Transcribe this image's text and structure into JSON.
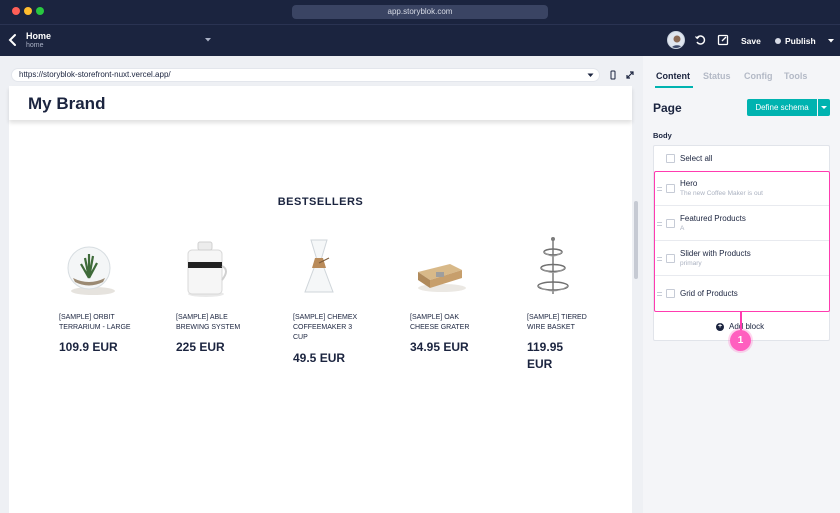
{
  "window": {
    "url": "app.storyblok.com"
  },
  "header": {
    "title": "Home",
    "subtitle": "home",
    "save_label": "Save",
    "publish_label": "Publish"
  },
  "preview": {
    "url": "https://storyblok-storefront-nuxt.vercel.app/",
    "brand": "My Brand",
    "section_title": "BESTSELLERS",
    "products": [
      {
        "name": "[SAMPLE] ORBIT TERRARIUM - LARGE",
        "price": "109.9 EUR"
      },
      {
        "name": "[SAMPLE] ABLE BREWING SYSTEM",
        "price": "225 EUR"
      },
      {
        "name": "[SAMPLE] CHEMEX COFFEEMAKER 3 CUP",
        "price": "49.5 EUR"
      },
      {
        "name": "[SAMPLE] OAK CHEESE GRATER",
        "price": "34.95 EUR"
      },
      {
        "name": "[SAMPLE] TIERED WIRE BASKET",
        "price": "119.95 EUR"
      }
    ]
  },
  "panel": {
    "tabs": [
      "Content",
      "Status",
      "Config",
      "Tools"
    ],
    "title": "Page",
    "define_schema_label": "Define schema",
    "body_label": "Body",
    "select_all_label": "Select all",
    "blocks": [
      {
        "title": "Hero",
        "subtitle": "The new Coffee Maker is out"
      },
      {
        "title": "Featured Products",
        "subtitle": "A"
      },
      {
        "title": "Slider with Products",
        "subtitle": "primary"
      },
      {
        "title": "Grid of Products",
        "subtitle": ""
      }
    ],
    "add_block_label": "Add block",
    "callout_number": "1"
  },
  "colors": {
    "app_bg": "#1b243f",
    "accent": "#00b3b0",
    "highlight": "#ff3bb0"
  }
}
